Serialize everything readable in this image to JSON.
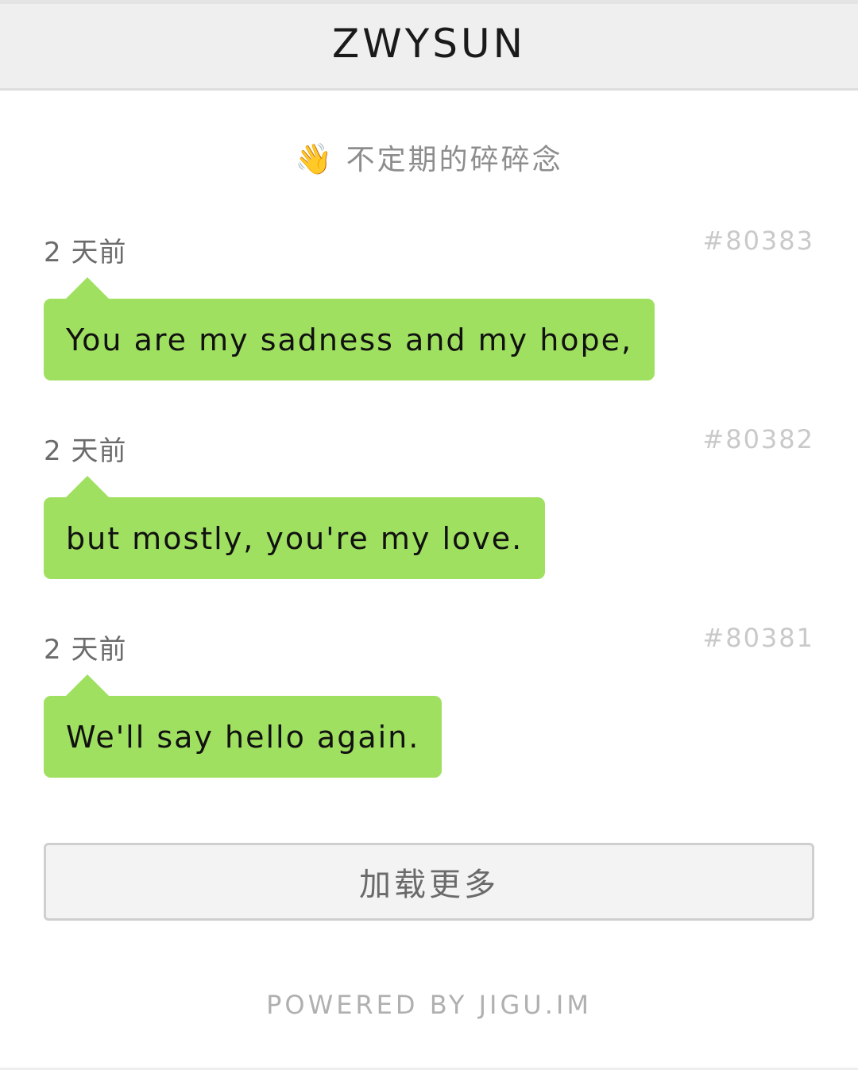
{
  "header": {
    "title": "ZWYSUN"
  },
  "subtitle": {
    "emoji": "👋",
    "icon": "waving-hand-icon",
    "text": "不定期的碎碎念"
  },
  "posts": [
    {
      "time": "2 天前",
      "id": "#80383",
      "text": "You are my sadness and my hope,"
    },
    {
      "time": "2 天前",
      "id": "#80382",
      "text": "but mostly, you're my love."
    },
    {
      "time": "2 天前",
      "id": "#80381",
      "text": "We'll say hello again."
    }
  ],
  "load_more": {
    "label": "加载更多"
  },
  "footer": {
    "text": "POWERED BY JIGU.IM"
  },
  "colors": {
    "bubble": "#9fe060",
    "header_bg": "#efefef"
  }
}
